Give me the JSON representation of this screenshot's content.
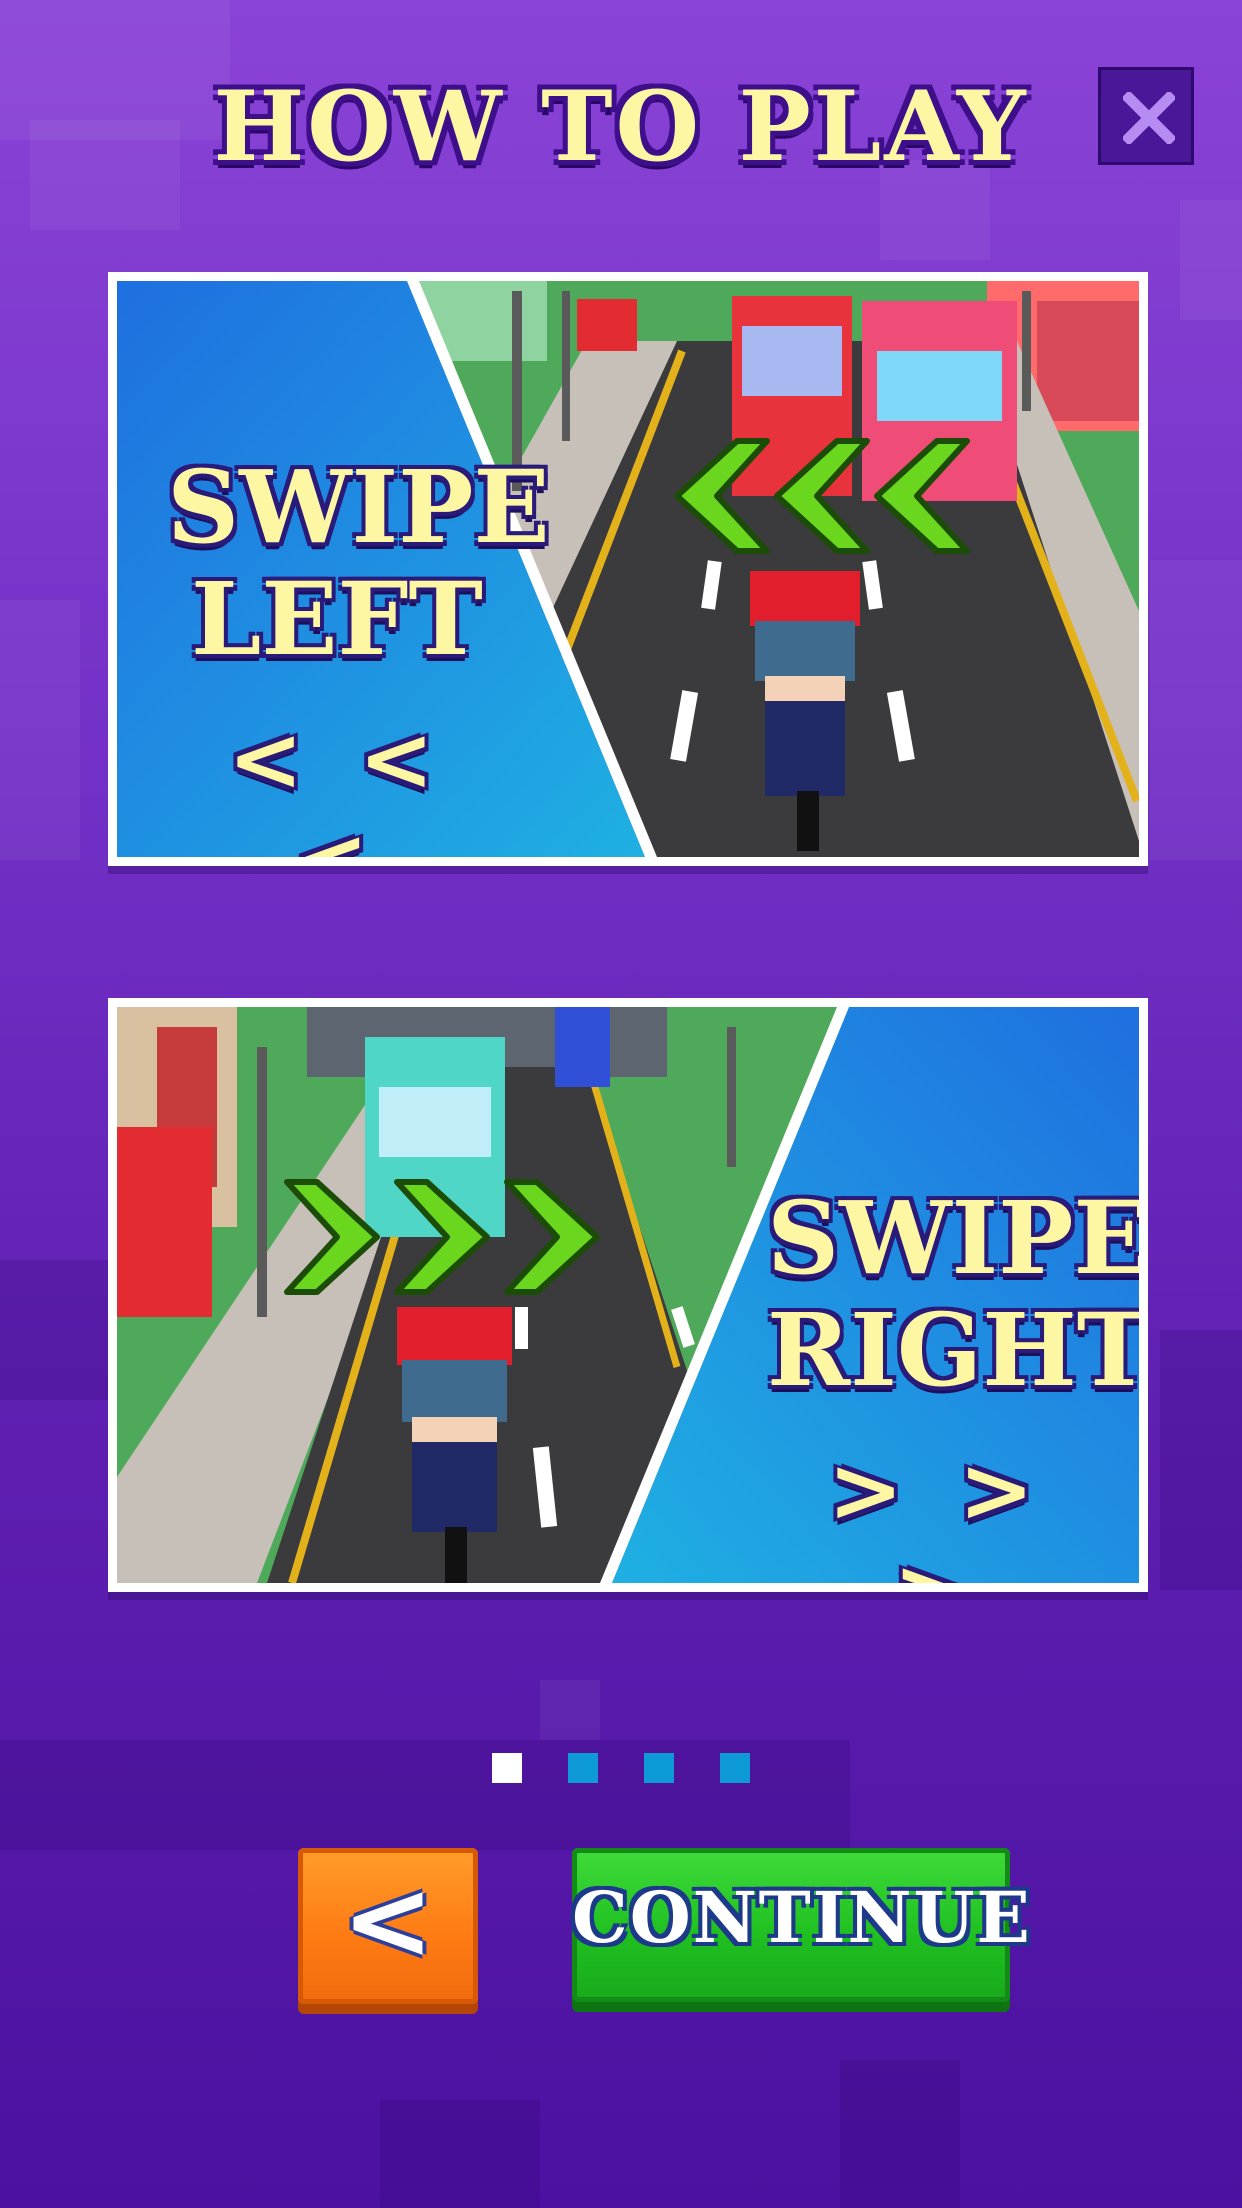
{
  "header": {
    "title": "HOW TO PLAY",
    "close_icon": "close-x-icon"
  },
  "cards": [
    {
      "word": "SWIPE",
      "direction": "LEFT",
      "arrows": "< < <",
      "scene_icon": "left-chevrons-icon"
    },
    {
      "word": "SWIPE",
      "direction": "RIGHT",
      "arrows": "> > >",
      "scene_icon": "right-chevrons-icon"
    }
  ],
  "pagination": {
    "total": 4,
    "current": 1
  },
  "buttons": {
    "back_label": "<",
    "continue_label": "CONTINUE"
  },
  "colors": {
    "title": "#fdf7a3",
    "chevron_green": "#6ad61e",
    "back_orange": "#ff7c14",
    "continue_green": "#20c121",
    "dot_inactive": "#0d9ad6",
    "dot_active": "#ffffff"
  }
}
